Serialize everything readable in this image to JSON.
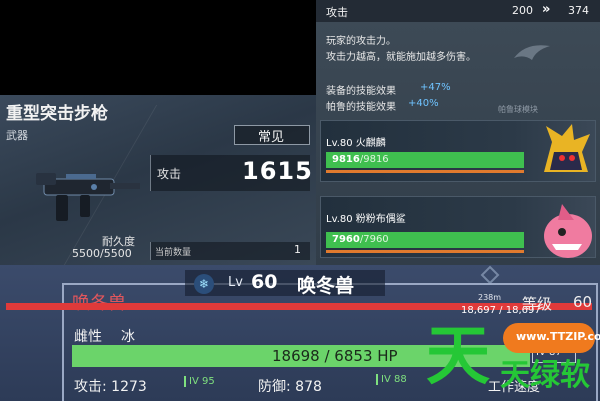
{
  "weapon": {
    "title": "重型突击步枪",
    "type": "武器",
    "rarity": "常见",
    "durability_label": "耐久度",
    "durability_value": "5500/5500",
    "attack_label": "攻击",
    "attack_value": "1615",
    "quantity_label": "当前数量",
    "quantity_value": "1",
    "icon": "assault-rifle-icon"
  },
  "stat": {
    "name": "攻击",
    "current": "200",
    "arrow": "»",
    "next": "374",
    "desc_line1": "玩家的攻击力。",
    "desc_line2": "攻击力越高，就能施加越多伤害。",
    "bonus1_label": "装备的技能效果",
    "bonus1_value": "+47%",
    "bonus2_label": "帕鲁的技能效果",
    "bonus2_value": "+40%",
    "module_label": "帕鲁球模块",
    "accent_color": "#6fc3ff"
  },
  "pals": [
    {
      "name": "Lv.80 火麒麟",
      "hp": "9816",
      "hp_max": "/9816",
      "hp_fraction": 1.0,
      "portrait": "fire-qilin-portrait"
    },
    {
      "name": "Lv.80 粉粉布偶鲨",
      "hp": "7960",
      "hp_max": "/7960",
      "hp_fraction": 1.0,
      "portrait": "pink-shark-portrait"
    }
  ],
  "detail": {
    "level_label": "Lv",
    "level_value": "60",
    "header_name": "唤冬兽",
    "name_ghost": "唤冬兽",
    "distance": "238m",
    "hp_small": "18,697 / 18,697",
    "grade_label": "等级",
    "grade_value": "60",
    "gender_label": "雌性",
    "element_label": "冰",
    "big_hp": "18698 / 6853 HP",
    "iv_badge": "IV 87",
    "attack_label": "攻击: 1273",
    "iv_attack": "IV 95",
    "defense_label": "防御: 878",
    "iv_defense": "IV 88",
    "work_label": "工作速度",
    "hp_bar_color": "#6bd46a",
    "name_color": "#e2565c"
  },
  "watermark": {
    "url": "www.TTZIP.com",
    "logo": "天",
    "sub": "天绿软"
  }
}
